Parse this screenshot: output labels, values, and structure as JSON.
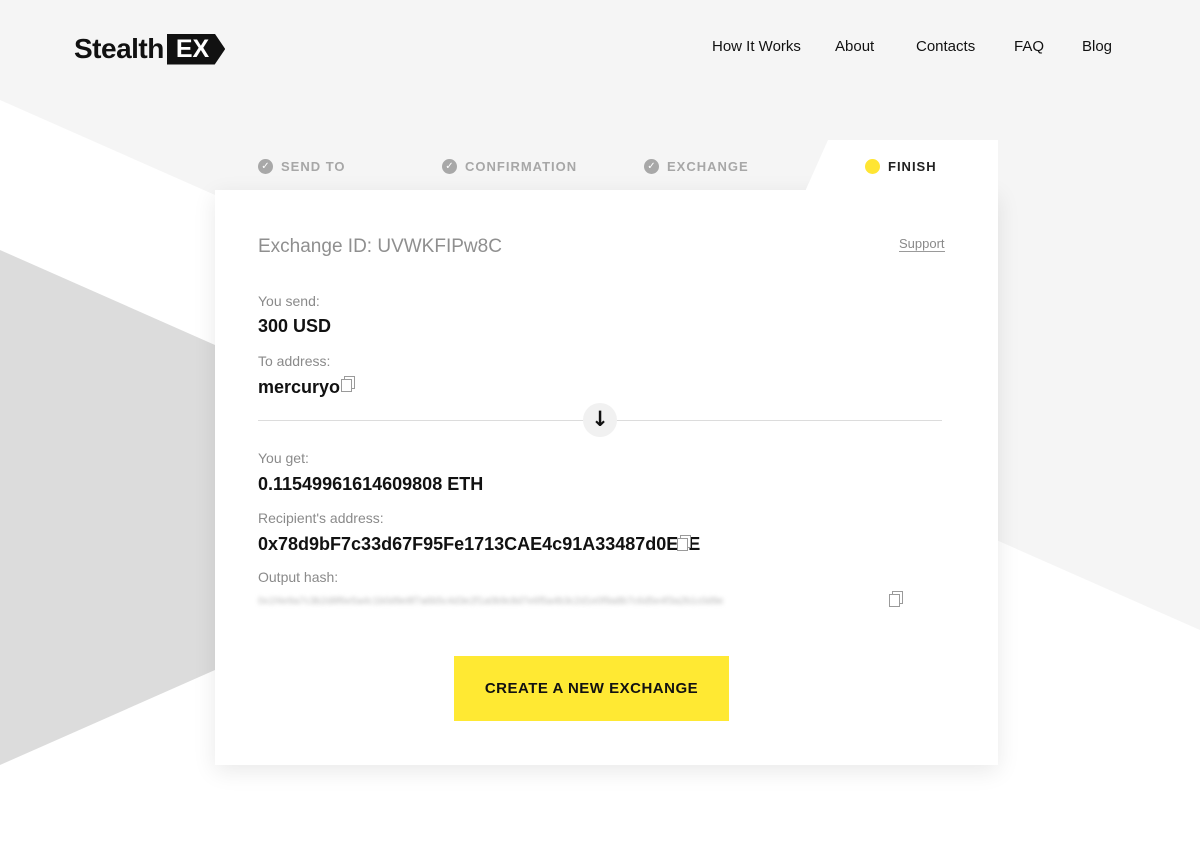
{
  "brand": {
    "name": "Stealth",
    "suffix": "EX"
  },
  "nav": [
    {
      "label": "How It Works"
    },
    {
      "label": "About"
    },
    {
      "label": "Contacts"
    },
    {
      "label": "FAQ"
    },
    {
      "label": "Blog"
    }
  ],
  "steps": [
    {
      "label": "SEND TO",
      "status": "done"
    },
    {
      "label": "CONFIRMATION",
      "status": "done"
    },
    {
      "label": "EXCHANGE",
      "status": "done"
    },
    {
      "label": "FINISH",
      "status": "active"
    }
  ],
  "exchange": {
    "id_text": "Exchange ID: UVWKFIPw8C",
    "support_label": "Support",
    "send_label": "You send:",
    "send_value": "300 USD",
    "to_label": "To address:",
    "to_value": "mercuryo",
    "get_label": "You get:",
    "get_value": "0.11549961614609808 ETH",
    "recipient_label": "Recipient's address:",
    "recipient_value": "0x78d9bF7c33d67F95Fe1713CAE4c91A33487d0EeE",
    "hash_label": "Output hash:",
    "hash_value": "0x1f4e9a7c3b2d8f6e5a4c1b0d9e8f7a6b5c4d3e2f1a0b9c8d7e6f5a4b3c2d1e0f9a8b7c6d5e4f3a2b1c0d9e"
  },
  "cta": {
    "label": "CREATE A NEW EXCHANGE"
  },
  "colors": {
    "accent": "#FFE933",
    "text": "#111111",
    "muted": "#8A8A8A",
    "page_bg": "#F5F5F5"
  }
}
